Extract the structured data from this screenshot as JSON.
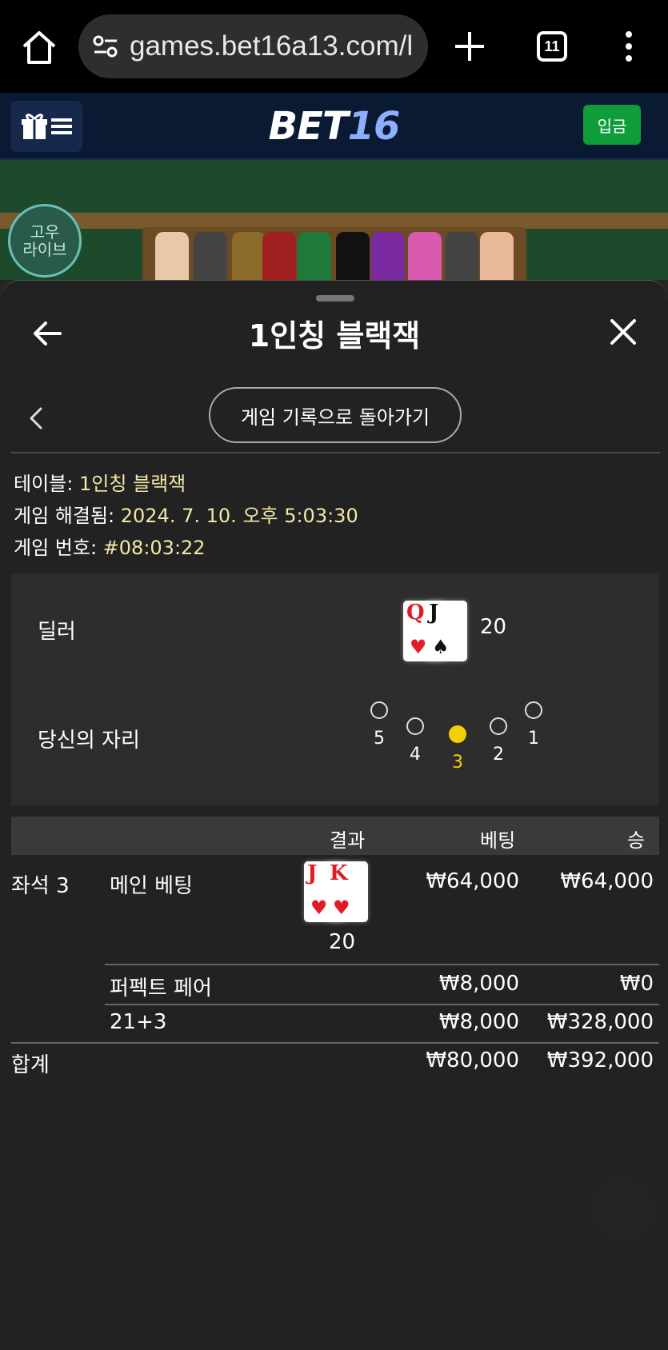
{
  "browser": {
    "url": "games.bet16a13.com/l",
    "tab_count": "11"
  },
  "site": {
    "logo_main": "BET",
    "logo_num": "16",
    "deposit_label": "입금"
  },
  "game_bg": {
    "live_badge_top": "고우",
    "live_badge_bottom": "라이브"
  },
  "panel": {
    "title": "1인칭 블랙잭",
    "back_to_history": "게임 기록으로 돌아가기",
    "table_label": "테이블: ",
    "table_value": "1인칭 블랙잭",
    "resolved_label": "게임 해결됨: ",
    "resolved_value": "2024. 7. 10. 오후 5:03:30",
    "number_label": "게임 번호: ",
    "number_value": "#08:03:22"
  },
  "hands": {
    "dealer_label": "딜러",
    "dealer_cards": [
      {
        "rank": "Q",
        "suit": "♥",
        "color": "#e01b24"
      },
      {
        "rank": "J",
        "suit": "♠",
        "color": "#111111"
      }
    ],
    "dealer_score": "20",
    "seat_label": "당신의 자리",
    "seats": [
      "5",
      "4",
      "3",
      "2",
      "1"
    ],
    "active_seat": "3"
  },
  "results": {
    "headers": {
      "result": "결과",
      "bet": "베팅",
      "win": "승"
    },
    "seat_name": "좌석 3",
    "rows": [
      {
        "name": "메인 베팅",
        "bet": "₩64,000",
        "win": "₩64,000"
      },
      {
        "name": "퍼펙트 페어",
        "bet": "₩8,000",
        "win": "₩0"
      },
      {
        "name": "21+3",
        "bet": "₩8,000",
        "win": "₩328,000"
      }
    ],
    "player_cards": [
      {
        "rank": "J",
        "suit": "♥",
        "color": "#e01b24"
      },
      {
        "rank": "K",
        "suit": "♥",
        "color": "#e01b24"
      }
    ],
    "player_score": "20",
    "total_label": "합계",
    "total_bet": "₩80,000",
    "total_win": "₩392,000"
  },
  "colors": {
    "accent_gold": "#f5d000",
    "value_cream": "#f3e7a6",
    "deposit_green": "#0f9d3a",
    "header_navy": "#0b1a33"
  }
}
